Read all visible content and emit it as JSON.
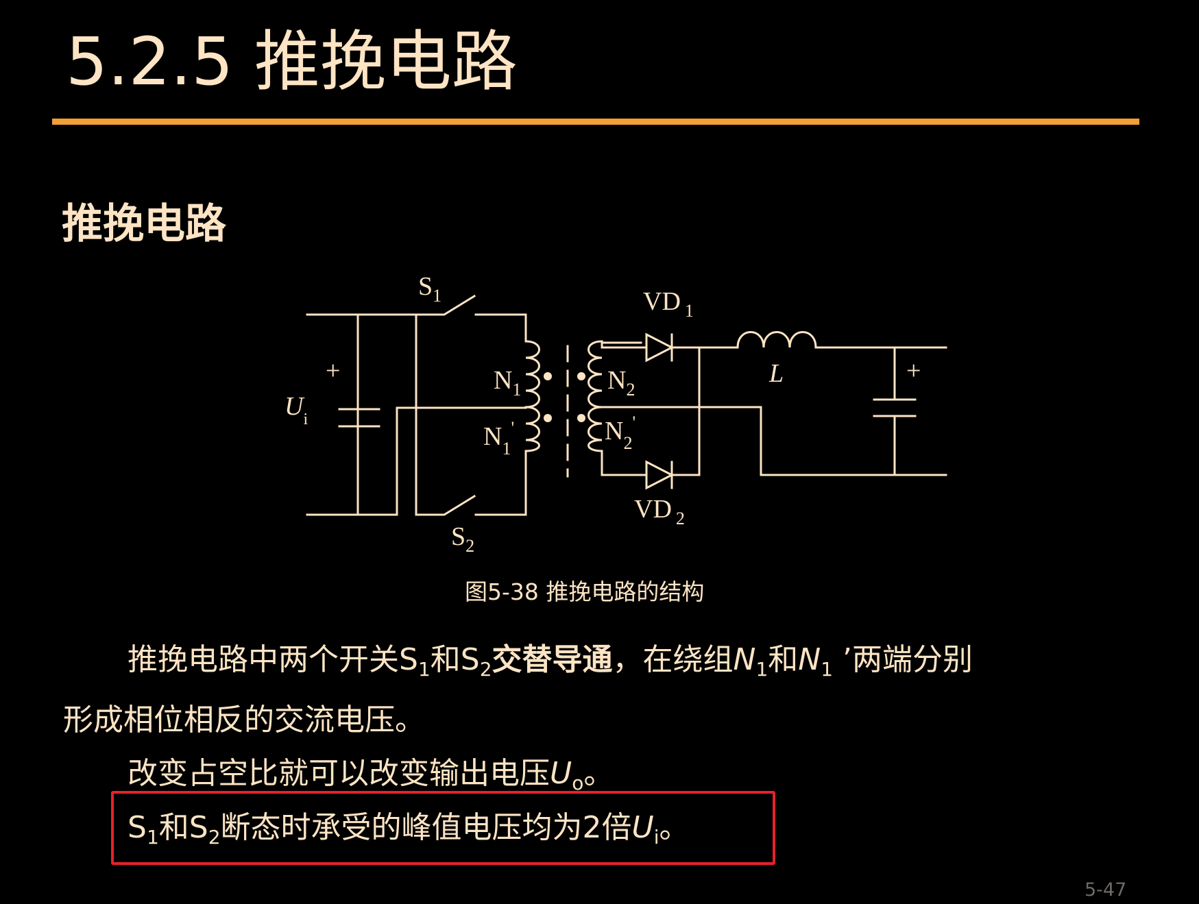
{
  "slide": {
    "title": "5.2.5  推挽电路",
    "section_heading": "推挽电路",
    "caption": "图5-38  推挽电路的结构",
    "page_number": "5-47"
  },
  "diagram": {
    "labels": {
      "s1": "S",
      "s1_sub": "1",
      "s2": "S",
      "s2_sub": "2",
      "vd1": "VD",
      "vd1_sub": "1",
      "vd2": "VD",
      "vd2_sub": "2",
      "n1": "N",
      "n1_sub": "1",
      "n1p": "N",
      "n1p_sub": "1",
      "n1p_prime": "'",
      "n2": "N",
      "n2_sub": "2",
      "n2p": "N",
      "n2p_sub": "2",
      "n2p_prime": "'",
      "inductor": "L",
      "input": "U",
      "input_sub": "i",
      "input_plus": "+",
      "output_plus": "+"
    }
  },
  "paragraphs": {
    "p1": {
      "t1": "推挽电路中两个开关S",
      "s1": "1",
      "t2": "和S",
      "s2": "2",
      "bold": "交替导通",
      "t3": "，在绕组",
      "n1": "N",
      "n1_sub": "1",
      "t4": "和",
      "n1b": "N",
      "n1b_sub": "1",
      "t5": " ’两端分别"
    },
    "p2": {
      "text": "形成相位相反的交流电压。"
    },
    "p3": {
      "t1": "改变占空比就可以改变输出电压",
      "u": "U",
      "u_sub": "o",
      "end": "。"
    },
    "p4": {
      "t1": "S",
      "s1": "1",
      "t2": "和S",
      "s2": "2",
      "t3": "断态时承受的峰值电压均为2倍",
      "u": "U",
      "u_sub": "i",
      "end": "。"
    }
  },
  "colors": {
    "background": "#000000",
    "text": "#FCE4C4",
    "accent_rule": "#F29F36",
    "highlight_box": "#E8212B",
    "page_number": "#6E6A66"
  }
}
